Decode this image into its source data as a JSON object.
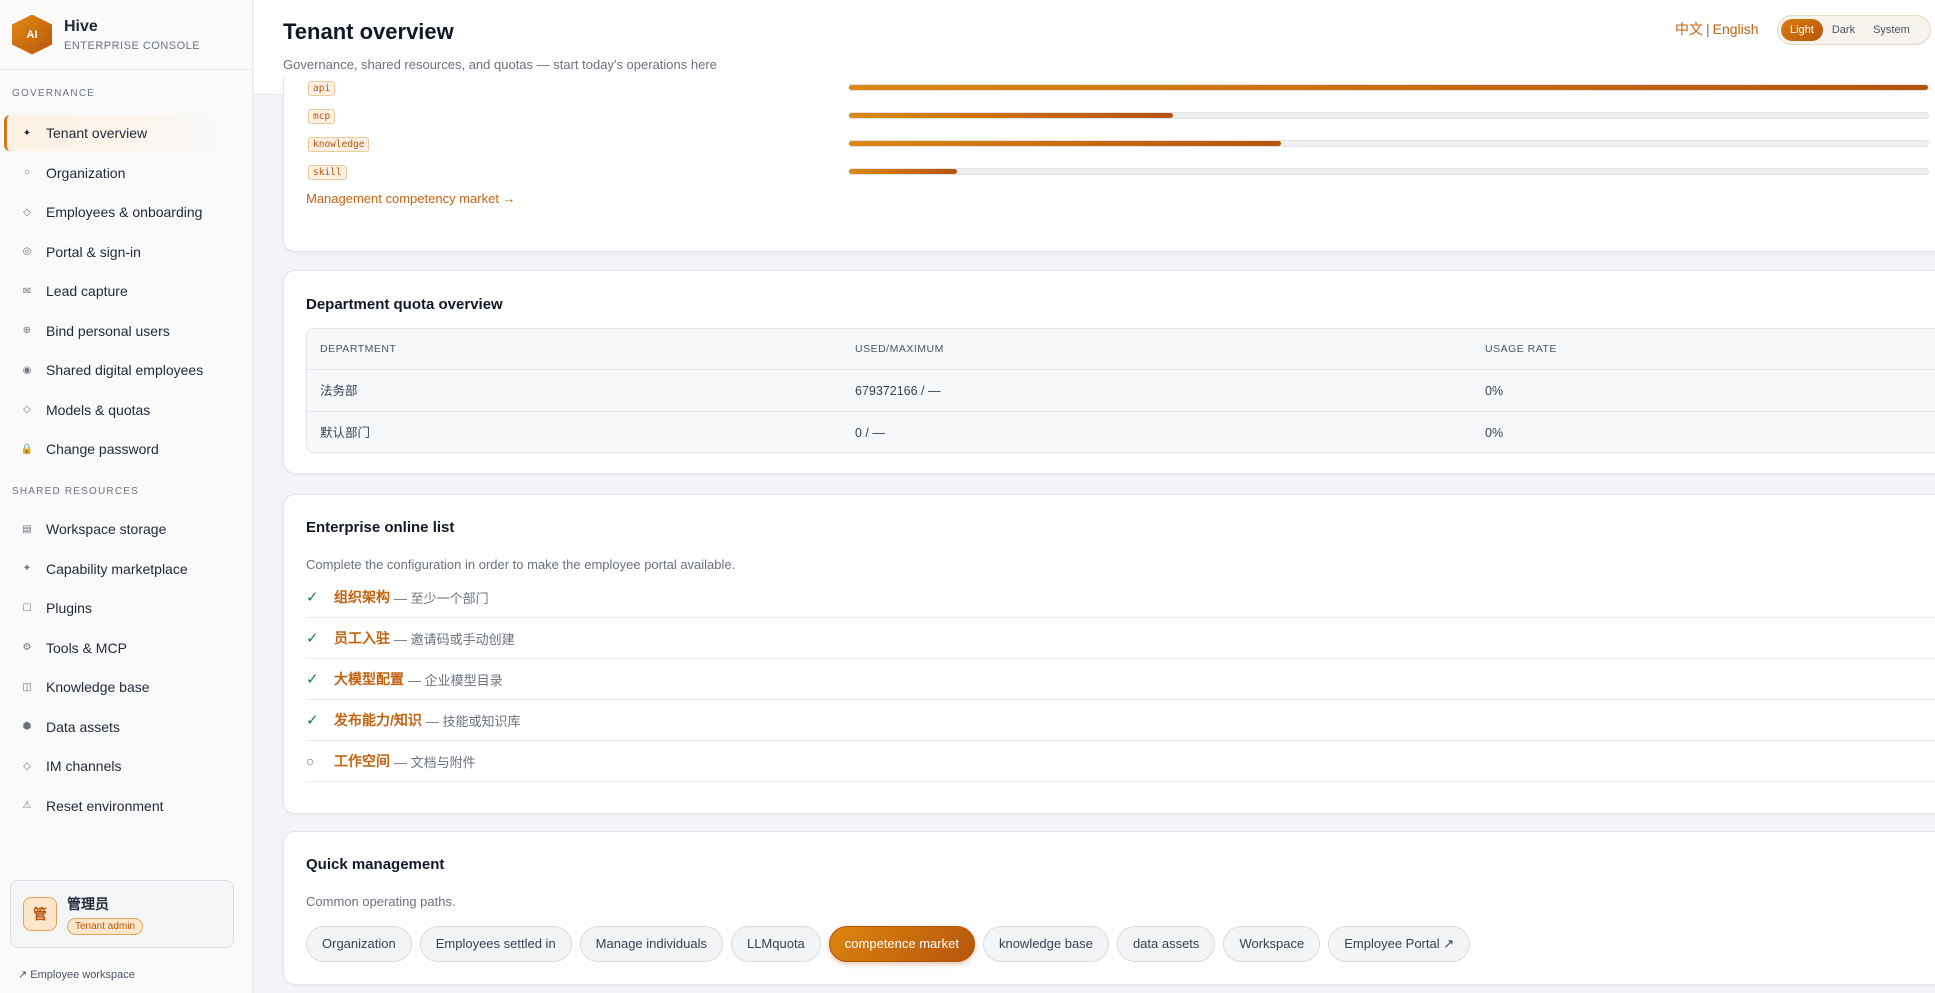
{
  "brand": {
    "logo": "AI",
    "name": "Hive",
    "subtitle": "ENTERPRISE CONSOLE"
  },
  "sidebar": {
    "governance_label": "GOVERNANCE",
    "governance_items": [
      {
        "label": "Tenant overview",
        "icon": "sparkle-icon",
        "glyph": "✦",
        "active": true
      },
      {
        "label": "Organization",
        "icon": "circle-icon",
        "glyph": "○"
      },
      {
        "label": "Employees & onboarding",
        "icon": "diamond-icon",
        "glyph": "◇"
      },
      {
        "label": "Portal & sign-in",
        "icon": "target-icon",
        "glyph": "◎"
      },
      {
        "label": "Lead capture",
        "icon": "mail-icon",
        "glyph": "✉"
      },
      {
        "label": "Bind personal users",
        "icon": "link-circle-icon",
        "glyph": "⊕"
      },
      {
        "label": "Shared digital employees",
        "icon": "radio-icon",
        "glyph": "◉"
      },
      {
        "label": "Models & quotas",
        "icon": "diamond-small-icon",
        "glyph": "◇"
      },
      {
        "label": "Change password",
        "icon": "lock-icon",
        "glyph": "🔒"
      }
    ],
    "shared_label": "SHARED RESOURCES",
    "shared_items": [
      {
        "label": "Workspace storage",
        "icon": "storage-icon",
        "glyph": "▤"
      },
      {
        "label": "Capability marketplace",
        "icon": "sparkle-icon",
        "glyph": "✦"
      },
      {
        "label": "Plugins",
        "icon": "square-icon",
        "glyph": "☐"
      },
      {
        "label": "Tools & MCP",
        "icon": "gear-icon",
        "glyph": "⚙"
      },
      {
        "label": "Knowledge base",
        "icon": "book-icon",
        "glyph": "◫"
      },
      {
        "label": "Data assets",
        "icon": "hexagon-icon",
        "glyph": "⬢"
      },
      {
        "label": "IM channels",
        "icon": "chat-icon",
        "glyph": "◇"
      },
      {
        "label": "Reset environment",
        "icon": "warning-icon",
        "glyph": "⚠"
      }
    ],
    "user": {
      "avatar": "管",
      "name": "管理员",
      "role": "Tenant admin"
    },
    "employee_workspace": "↗ Employee workspace"
  },
  "header": {
    "title": "Tenant overview",
    "subtitle": "Governance, shared resources, and quotas — start today's operations here",
    "lang_zh": "中文",
    "lang_sep": "|",
    "lang_en": "English",
    "themes": [
      "Light",
      "Dark",
      "System"
    ],
    "active_theme": "Light"
  },
  "capabilities": {
    "rows": [
      {
        "tag": "api",
        "fill": 1.0
      },
      {
        "tag": "mcp",
        "fill": 0.3
      },
      {
        "tag": "knowledge",
        "fill": 0.4
      },
      {
        "tag": "skill",
        "fill": 0.1
      }
    ],
    "link": "Management competency market →"
  },
  "quota": {
    "title": "Department quota overview",
    "headers": [
      "DEPARTMENT",
      "USED/MAXIMUM",
      "USAGE RATE"
    ],
    "rows": [
      [
        "法务部",
        "679372166 / —",
        "0%"
      ],
      [
        "默认部门",
        "0 / —",
        "0%"
      ]
    ]
  },
  "online_list": {
    "title": "Enterprise online list",
    "desc": "Complete the configuration in order to make the employee portal available.",
    "items": [
      {
        "done": true,
        "name": "组织架构",
        "desc": "— 至少一个部门",
        "icon": "check-icon",
        "mark": "✓"
      },
      {
        "done": true,
        "name": "员工入驻",
        "desc": "— 邀请码或手动创建",
        "icon": "check-icon",
        "mark": "✓"
      },
      {
        "done": true,
        "name": "大模型配置",
        "desc": "— 企业模型目录",
        "icon": "check-icon",
        "mark": "✓"
      },
      {
        "done": true,
        "name": "发布能力/知识",
        "desc": "— 技能或知识库",
        "icon": "check-icon",
        "mark": "✓"
      },
      {
        "done": false,
        "name": "工作空间",
        "desc": "— 文档与附件",
        "icon": "open-circle-icon",
        "mark": "○"
      }
    ]
  },
  "quick": {
    "title": "Quick management",
    "desc": "Common operating paths.",
    "chips": [
      {
        "label": "Organization"
      },
      {
        "label": "Employees settled in"
      },
      {
        "label": "Manage individuals"
      },
      {
        "label": "LLMquota"
      },
      {
        "label": "competence market",
        "highlight": true
      },
      {
        "label": "knowledge base"
      },
      {
        "label": "data assets"
      },
      {
        "label": "Workspace"
      },
      {
        "label": "Employee Portal ↗"
      }
    ]
  },
  "colors": {
    "accent": "#c26312",
    "accent_dark": "#b5540b",
    "success": "#16834a"
  }
}
